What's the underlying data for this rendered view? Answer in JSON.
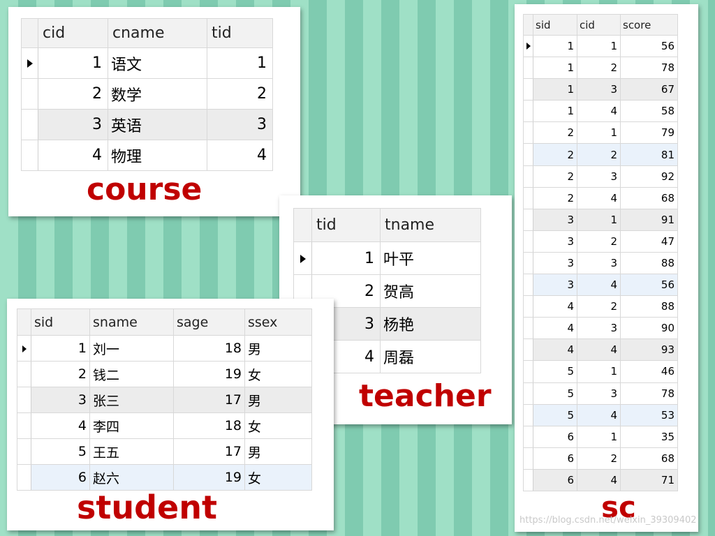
{
  "course": {
    "caption": "course",
    "columns": [
      "cid",
      "cname",
      "tid"
    ],
    "rows": [
      [
        "1",
        "语文",
        "1"
      ],
      [
        "2",
        "数学",
        "2"
      ],
      [
        "3",
        "英语",
        "3"
      ],
      [
        "4",
        "物理",
        "4"
      ]
    ]
  },
  "teacher": {
    "caption": "teacher",
    "columns": [
      "tid",
      "tname"
    ],
    "rows": [
      [
        "1",
        "叶平"
      ],
      [
        "2",
        "贺高"
      ],
      [
        "3",
        "杨艳"
      ],
      [
        "4",
        "周磊"
      ]
    ]
  },
  "student": {
    "caption": "student",
    "columns": [
      "sid",
      "sname",
      "sage",
      "ssex"
    ],
    "rows": [
      [
        "1",
        "刘一",
        "18",
        "男"
      ],
      [
        "2",
        "钱二",
        "19",
        "女"
      ],
      [
        "3",
        "张三",
        "17",
        "男"
      ],
      [
        "4",
        "李四",
        "18",
        "女"
      ],
      [
        "5",
        "王五",
        "17",
        "男"
      ],
      [
        "6",
        "赵六",
        "19",
        "女"
      ]
    ]
  },
  "sc": {
    "caption": "sc",
    "columns": [
      "sid",
      "cid",
      "score"
    ],
    "rows": [
      [
        "1",
        "1",
        "56"
      ],
      [
        "1",
        "2",
        "78"
      ],
      [
        "1",
        "3",
        "67"
      ],
      [
        "1",
        "4",
        "58"
      ],
      [
        "2",
        "1",
        "79"
      ],
      [
        "2",
        "2",
        "81"
      ],
      [
        "2",
        "3",
        "92"
      ],
      [
        "2",
        "4",
        "68"
      ],
      [
        "3",
        "1",
        "91"
      ],
      [
        "3",
        "2",
        "47"
      ],
      [
        "3",
        "3",
        "88"
      ],
      [
        "3",
        "4",
        "56"
      ],
      [
        "4",
        "2",
        "88"
      ],
      [
        "4",
        "3",
        "90"
      ],
      [
        "4",
        "4",
        "93"
      ],
      [
        "5",
        "1",
        "46"
      ],
      [
        "5",
        "3",
        "78"
      ],
      [
        "5",
        "4",
        "53"
      ],
      [
        "6",
        "1",
        "35"
      ],
      [
        "6",
        "2",
        "68"
      ],
      [
        "6",
        "4",
        "71"
      ]
    ]
  },
  "watermark": "https://blog.csdn.net/weixin_39309402"
}
